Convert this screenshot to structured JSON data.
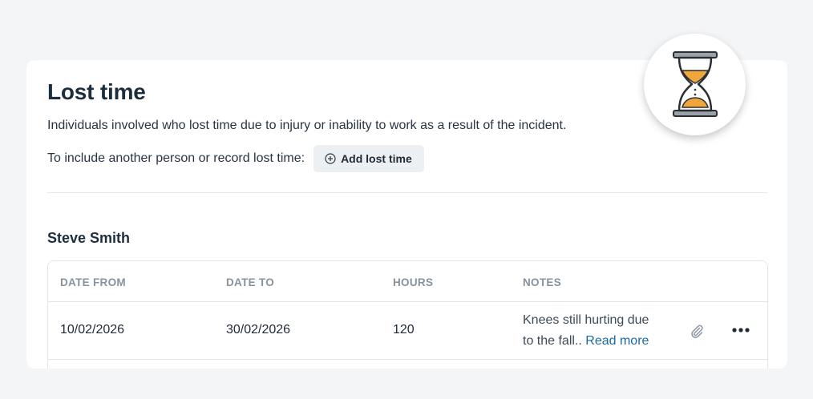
{
  "section": {
    "title": "Lost time",
    "description": "Individuals involved who lost time due to injury or inability to work as a result of the incident.",
    "include_prompt": "To include another person or record lost time:",
    "add_button_label": "Add lost time"
  },
  "person": {
    "name": "Steve Smith"
  },
  "table": {
    "columns": [
      "DATE FROM",
      "DATE TO",
      "HOURS",
      "NOTES"
    ],
    "rows": [
      {
        "date_from": "10/02/2026",
        "date_to": "30/02/2026",
        "hours": "120",
        "notes_line1": "Knees still hurting due",
        "notes_line2": "to the fall..",
        "read_more": "Read more"
      }
    ]
  },
  "icons": {
    "badge": "hourglass-icon",
    "add": "plus-circle-icon",
    "attachment": "paperclip-icon",
    "more": "more-horizontal-icon"
  },
  "colors": {
    "accent_link": "#1a6aa8",
    "hourglass_sand": "#f0a63a",
    "title": "#1c2e3e",
    "page_bg": "#f4f5f7"
  }
}
